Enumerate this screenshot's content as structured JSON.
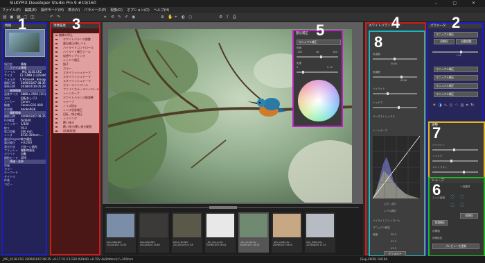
{
  "titlebar": {
    "app_title": "SILKYPIX Developer Studio Pro 9",
    "counter": "#19/160",
    "controls": "‒ ▢ ✕"
  },
  "menu": [
    "ファイル(F)",
    "編集(E)",
    "操作モード(M)",
    "表示(V)",
    "パラメータ(P)",
    "現像(D)",
    "オプション(O)",
    "ヘルプ(H)"
  ],
  "markers": [
    "1",
    "3",
    "5",
    "4",
    "2",
    "8",
    "7",
    "6"
  ],
  "region1": {
    "header": "情報",
    "rows": [
      {
        "k": "項目名",
        "v": "情報"
      },
      {
        "k": "",
        "v": "ファイル情報",
        "sec": true
      },
      {
        "k": "ファイル",
        "v": "_MG_0238.CR2"
      },
      {
        "k": "サイズ",
        "v": "12.73MB (1335066)"
      },
      {
        "k": "フォルダ",
        "v": "C:¥Users¥...¥image"
      },
      {
        "k": "撮影日時",
        "v": "2009/03/07 08:35"
      },
      {
        "k": "更新日時",
        "v": "2018/07/30 05:29"
      },
      {
        "k": "",
        "v": "画像情報",
        "sec": true
      },
      {
        "k": "画像サイズ",
        "v": "3888 x 2592 (1/1)"
      },
      {
        "k": "方向",
        "v": "回転なし (1)"
      },
      {
        "k": "メーカー",
        "v": "Canon"
      },
      {
        "k": "機種",
        "v": "Canon EOS 40D"
      },
      {
        "k": "色空間",
        "v": "AdobeRGB"
      },
      {
        "k": "",
        "v": "撮影情報",
        "sec": true
      },
      {
        "k": "撮影日時",
        "v": "2009/03/07 08:35"
      },
      {
        "k": "ISO感度",
        "v": "ISO640"
      },
      {
        "k": "シャッター",
        "v": "1/320"
      },
      {
        "k": "絞り",
        "v": "F6.3"
      },
      {
        "k": "焦点距離",
        "v": "200 mm"
      },
      {
        "k": "レンズ",
        "v": "EF35-350mm ..."
      },
      {
        "k": "露出Program",
        "v": "絞り優先"
      },
      {
        "k": "露出補正",
        "v": "+0.0 EV"
      },
      {
        "k": "測光方式",
        "v": "パターン測光"
      },
      {
        "k": "フラッシュ",
        "v": "撮影時発光"
      },
      {
        "k": "ホワイト",
        "v": "自動"
      },
      {
        "k": "撮影モード",
        "v": "GPS"
      },
      {
        "k": "",
        "v": "評価・注釈",
        "sec": true
      },
      {
        "k": "評価",
        "v": ""
      },
      {
        "k": "カラー",
        "v": ""
      },
      {
        "k": "キーワード",
        "v": ""
      },
      {
        "k": "タイトル",
        "v": ""
      },
      {
        "k": "作者",
        "v": ""
      },
      {
        "k": "コピー",
        "v": ""
      }
    ]
  },
  "region3": {
    "header": "現像履歴",
    "items": [
      {
        "label": "編集の停止",
        "sub": false
      },
      {
        "label": "ホワイトバランス調整",
        "sub": true
      },
      {
        "label": "露出補正/黒レベル",
        "sub": true
      },
      {
        "label": "ハイライトコントロール",
        "sub": true
      },
      {
        "label": "ハイライト補正ツール",
        "sub": true
      },
      {
        "label": "仮想サンプリング",
        "sub": true
      },
      {
        "label": "シャドウ補正",
        "sub": true
      },
      {
        "label": "調子",
        "sub": true
      },
      {
        "label": "カラー",
        "sub": true
      },
      {
        "label": "スタイリッシュテーマ",
        "sub": true
      },
      {
        "label": "スタイリッシュテーマ",
        "sub": true
      },
      {
        "label": "スタイリッシュテーマ",
        "sub": true
      },
      {
        "label": "カラーコントロール",
        "sub": true
      },
      {
        "label": "ファインカラーコントロール",
        "sub": true
      },
      {
        "label": "トーンカーブ",
        "sub": true
      },
      {
        "label": "ホワイトバランス微調整",
        "sub": true
      },
      {
        "label": "シャープ",
        "sub": true
      },
      {
        "label": "ノイズ除去",
        "sub": true
      },
      {
        "label": "レンズ収差補正",
        "sub": true
      },
      {
        "label": "回転・傾き補正",
        "sub": true
      },
      {
        "label": "トリミング",
        "sub": true
      },
      {
        "label": "覆い焼き",
        "sub": true
      },
      {
        "label": "覆い焼き/覆い焼き範囲",
        "sub": true
      },
      {
        "label": "(初期状態)",
        "sub": true
      }
    ]
  },
  "region5": {
    "header": "部分補正",
    "mode": "マニュアル補正",
    "slider1_label": "色相",
    "slider1_min": "-180",
    "slider1_max": "180",
    "slider1_value": "48",
    "slider2_label": "彩度",
    "slider2_value": "0",
    "slider2_max": "0.12"
  },
  "region4": {
    "header": "ホワイトバランス",
    "labels": [
      "色温度",
      "5000",
      "色偏差",
      "6586",
      "ハイライト",
      "シャドウ",
      "ベースマトリックス",
      "トーンカーブ",
      "入力 : 出力",
      "レベル補正",
      "ハイライトコントロール",
      "マニュアル補正",
      "強度",
      "36.2",
      "52.3",
      "42.3"
    ],
    "buttons": [
      "デフォルト"
    ]
  },
  "region2": {
    "header": "パラメータ",
    "presets": [
      "マニュアル補正",
      "初期化",
      "自動調整"
    ],
    "value1": "+24",
    "sliders": [
      "マニュアル補正",
      "マニュアル補正",
      "マニュアル補正",
      "マニュアル補正"
    ]
  },
  "region7": {
    "header": "調整",
    "labels": [
      "ハイライト",
      "シャドウ",
      "コントラスト"
    ]
  },
  "region6": {
    "header": "シャープ",
    "lbl1": "一括選択",
    "lbl2": "エッジ強調",
    "btn1": "初期化",
    "btn2": "色調補正",
    "footer1": "初期値",
    "footer2": "詳細設定",
    "footer3": "プレビューを更新"
  },
  "filmstrip": [
    {
      "name": "DSC5486.NEF",
      "info": "2012/03/01 10:52",
      "color": "#7a8ea8"
    },
    {
      "name": "DSC5584.NEF",
      "info": "2012/03/04 13:48",
      "color": "#3c3a38"
    },
    {
      "name": "DSC5785.NEF",
      "info": "2012/03/05 07:18",
      "color": "#5a5848"
    },
    {
      "name": "_MG_0012.CR2",
      "info": "2009/03/07 08:02",
      "color": "#e8e8e8"
    },
    {
      "name": "_MG_0238.CR2",
      "info": "2009/03/07 08:35",
      "color": "#708a72"
    },
    {
      "name": "_MG_0286.CR2",
      "info": "2009/03/07 09:01",
      "color": "#c8a882"
    },
    {
      "name": "IMG_9485.CR2",
      "info": "2015/08/05 17:22",
      "color": "#b7bcc4"
    }
  ],
  "statusbar": {
    "left": "_MG_0238.CR2 2009/03/07 08:35 +6.17 F6.3 1/320 ISO640 +0.7EV 4x(Pattern) f=200mm",
    "right": "[Sep,2600] 19/160"
  }
}
